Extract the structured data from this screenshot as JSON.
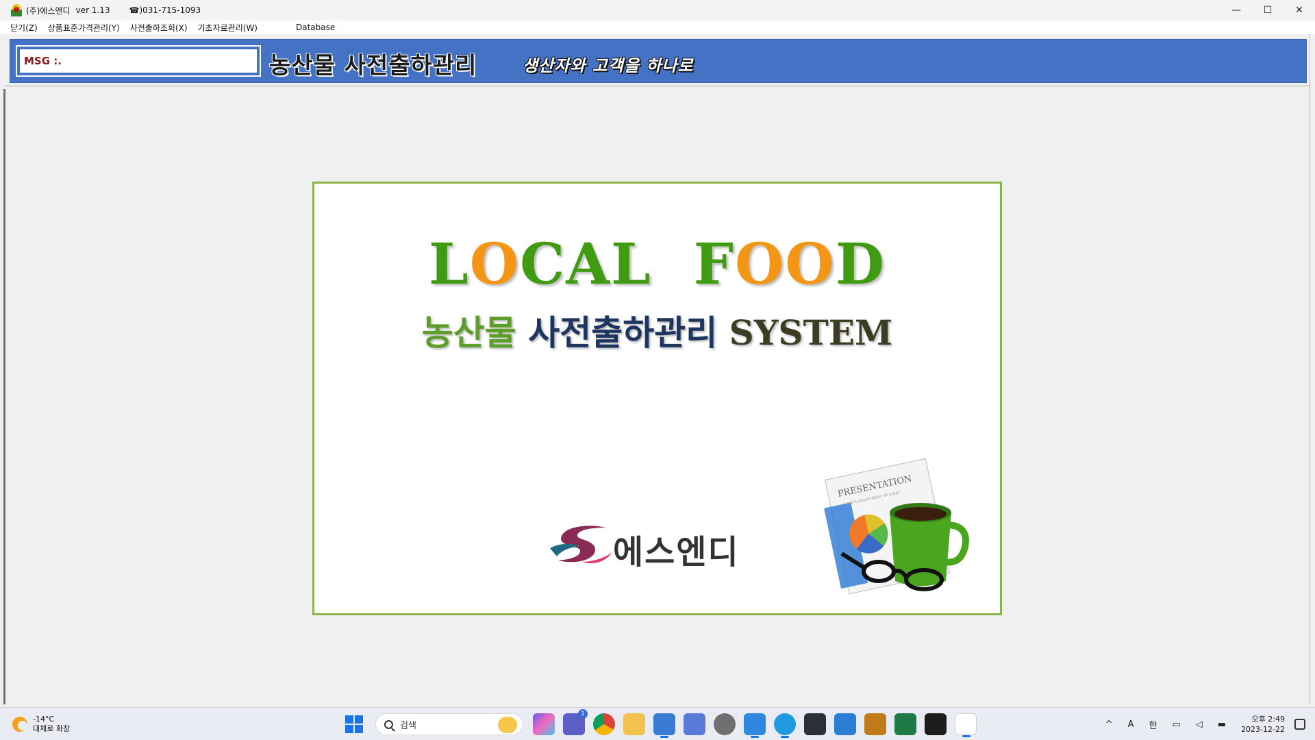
{
  "titlebar": {
    "title": "(주)에스엔디",
    "version": "ver 1.13",
    "phone": "☎)031-715-1093",
    "minimize": "—",
    "maximize": "☐",
    "close": "✕"
  },
  "menu": {
    "items": [
      "닫기(Z)",
      "상품표준가격관리(Y)",
      "사전출하조회(X)",
      "기초자료관리(W)",
      "Database"
    ]
  },
  "banner": {
    "msg_label": "MSG :.",
    "title": "농산물 사전출하관리",
    "slogan": "생산자와 고객을 하나로"
  },
  "splash": {
    "title_parts": [
      "L",
      "O",
      "CAL  F",
      "OO",
      "D"
    ],
    "subtitle_green": "농산물",
    "subtitle_navy": "사전출하관리",
    "subtitle_olive": "SYSTEM",
    "company_name": "에스엔디",
    "clipart_label": "PRESENTATION",
    "clipart_small": "Lorem ipsum dolor sit amet"
  },
  "colors": {
    "banner_blue": "#4472c4",
    "local_green": "#3f9c12",
    "food_orange": "#f39515",
    "panel_border": "#8db44a"
  },
  "taskbar": {
    "weather_temp": "-14°C",
    "weather_desc": "대체로 화창",
    "search_placeholder": "검색",
    "tray_chevron": "^",
    "tray_a": "A",
    "tray_ime": "한",
    "time": "오후 2:49",
    "date": "2023-12-22",
    "badge": "1"
  }
}
